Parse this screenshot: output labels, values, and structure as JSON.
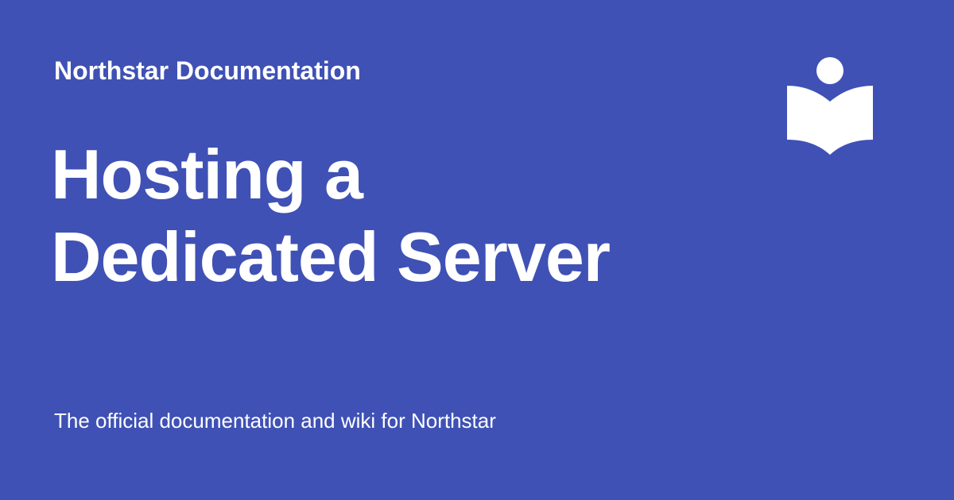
{
  "colors": {
    "background": "#3f51b5",
    "foreground": "#ffffff"
  },
  "header": {
    "site_name": "Northstar Documentation",
    "logo_icon": "book-reader-icon"
  },
  "main": {
    "title_lines": [
      "Hosting a",
      "Dedicated Server"
    ]
  },
  "footer": {
    "description": "The official documentation and wiki for Northstar"
  }
}
